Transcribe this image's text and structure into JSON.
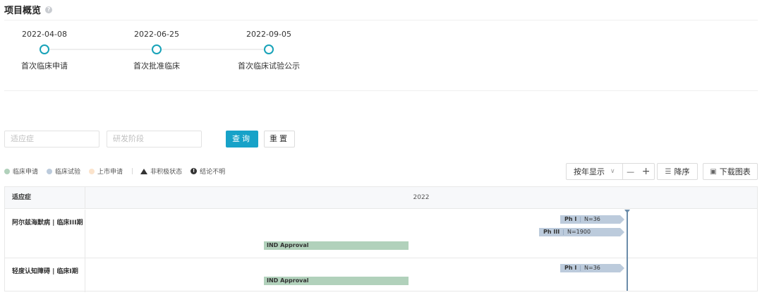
{
  "header": {
    "title": "项目概览",
    "help_icon": "?"
  },
  "milestones": [
    {
      "date": "2022-04-08",
      "label": "首次临床申请"
    },
    {
      "date": "2022-06-25",
      "label": "首次批准临床"
    },
    {
      "date": "2022-09-05",
      "label": "首次临床试验公示"
    }
  ],
  "filters": {
    "indication_placeholder": "适应症",
    "stage_placeholder": "研发阶段",
    "query_label": "查询",
    "reset_label": "重置"
  },
  "legend": {
    "items": [
      {
        "label": "临床申请",
        "color": "#b1d1bb"
      },
      {
        "label": "临床试验",
        "color": "#bccbdc"
      },
      {
        "label": "上市申请",
        "color": "#fbe3cc"
      }
    ],
    "inactive_label": "非积极状态",
    "unclear_label": "结论不明"
  },
  "toolbar": {
    "view_select": "按年显示",
    "zoom_out": "—",
    "zoom_in": "+",
    "sort_label": "降序",
    "download_label": "下载图表"
  },
  "table": {
    "col_indication": "适应症",
    "col_year": "2022",
    "rows": [
      {
        "indication": "阿尔兹海默病 | 临床III期",
        "trials": [
          {
            "phase": "Ph I",
            "n": "N=36"
          },
          {
            "phase": "Ph III",
            "n": "N=1900"
          }
        ],
        "approval": "IND Approval"
      },
      {
        "indication": "轻度认知障碍 | 临床I期",
        "trials": [
          {
            "phase": "Ph I",
            "n": "N=36"
          }
        ],
        "approval": "IND Approval"
      }
    ]
  },
  "colors": {
    "accent": "#17a2c8",
    "timeline": "#17a2b8",
    "ind": "#b1d1bb",
    "trial": "#bccbdc"
  }
}
